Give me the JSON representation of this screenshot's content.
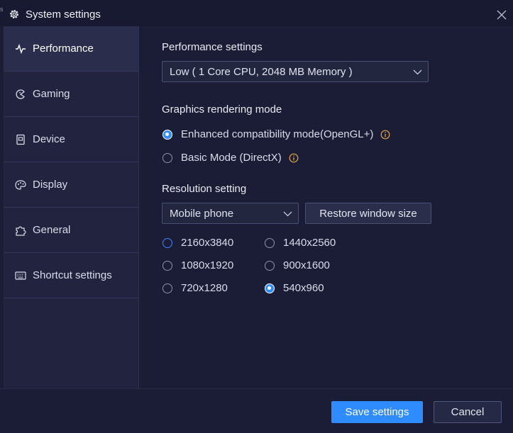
{
  "window": {
    "title": "System settings",
    "edge_mark": "s",
    "title_icon": "gear-icon",
    "close_icon": "close-icon"
  },
  "sidebar": {
    "items": [
      {
        "label": "Performance",
        "icon": "pulse-icon",
        "active": true
      },
      {
        "label": "Gaming",
        "icon": "gaming-icon",
        "active": false
      },
      {
        "label": "Device",
        "icon": "device-icon",
        "active": false
      },
      {
        "label": "Display",
        "icon": "display-palette-icon",
        "active": false
      },
      {
        "label": "General",
        "icon": "puzzle-icon",
        "active": false
      },
      {
        "label": "Shortcut settings",
        "icon": "keyboard-icon",
        "active": false
      }
    ]
  },
  "performance": {
    "title": "Performance settings",
    "selected": "Low ( 1 Core CPU, 2048 MB Memory )"
  },
  "graphics": {
    "title": "Graphics rendering mode",
    "options": [
      {
        "label": "Enhanced compatibility mode(OpenGL+)",
        "checked": true,
        "info_icon": "info-icon"
      },
      {
        "label": "Basic Mode (DirectX)",
        "checked": false,
        "info_icon": "info-icon"
      }
    ]
  },
  "resolution": {
    "title": "Resolution setting",
    "device_selected": "Mobile phone",
    "restore_label": "Restore window size",
    "options": [
      {
        "label": "2160x3840",
        "checked": false
      },
      {
        "label": "1440x2560",
        "checked": false
      },
      {
        "label": "1080x1920",
        "checked": false
      },
      {
        "label": "900x1600",
        "checked": false
      },
      {
        "label": "720x1280",
        "checked": false
      },
      {
        "label": "540x960",
        "checked": true
      }
    ]
  },
  "footer": {
    "save_label": "Save settings",
    "cancel_label": "Cancel"
  },
  "colors": {
    "accent": "#2f8cff",
    "background": "#1b1d36",
    "sidebar": "#22243f",
    "info": "#e0a341"
  }
}
